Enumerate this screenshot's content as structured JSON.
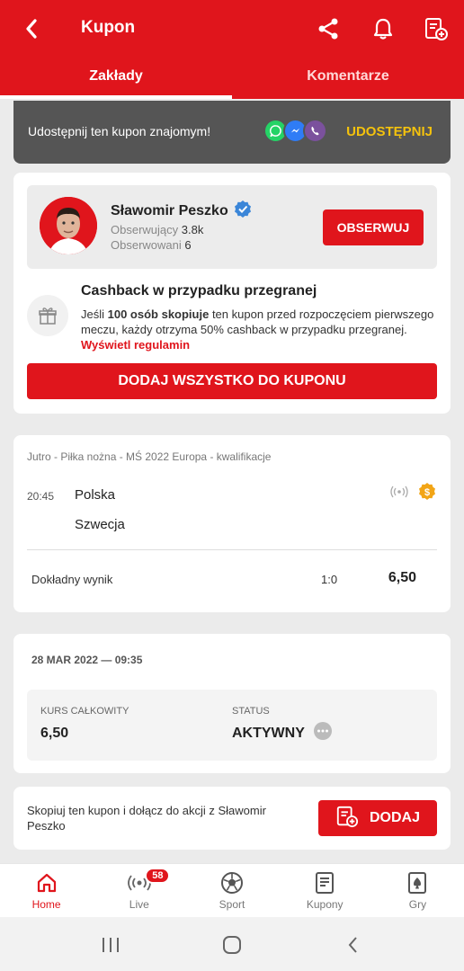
{
  "header": {
    "title": "Kupon",
    "icons": [
      "back-icon",
      "share-icon",
      "bell-icon",
      "coupon-add-icon"
    ],
    "tabs": [
      {
        "label": "Zakłady",
        "active": true
      },
      {
        "label": "Komentarze",
        "active": false
      }
    ]
  },
  "share_bar": {
    "text": "Udostępnij ten kupon znajomym!",
    "button": "UDOSTĘPNIJ",
    "apps": [
      "whatsapp-icon",
      "messenger-icon",
      "viber-icon"
    ]
  },
  "profile": {
    "name": "Sławomir Peszko",
    "followers_label": "Obserwujący",
    "followers_value": "3.8k",
    "following_label": "Obserwowani",
    "following_value": "6",
    "follow_button": "OBSERWUJ"
  },
  "cashback": {
    "title": "Cashback w przypadku przegranej",
    "text_1": "Jeśli ",
    "text_bold_1": "100 osób skopiuje",
    "text_2": " ten kupon przed rozpoczęciem pierwszego meczu, każdy otrzyma 50% cashback w przypadku przegranej. ",
    "link": "Wyświetl regulamin",
    "add_all_button": "DODAJ WSZYSTKO DO KUPONU"
  },
  "event": {
    "header": "Jutro - Piłka nożna - MŚ 2022 Europa - kwalifikacje",
    "time": "20:45",
    "home_team": "Polska",
    "away_team": "Szwecja",
    "market": "Dokładny wynik",
    "pick": "1:0",
    "odds": "6,50"
  },
  "summary": {
    "date": "28 MAR 2022 — 09:35",
    "total_odds_label": "KURS CAŁKOWITY",
    "total_odds_value": "6,50",
    "status_label": "STATUS",
    "status_value": "AKTYWNY"
  },
  "copy_bar": {
    "text": "Skopiuj ten kupon i dołącz do akcji z Sławomir Peszko",
    "button": "DODAJ"
  },
  "bottom_nav": [
    {
      "label": "Home",
      "icon": "home-icon",
      "active": true
    },
    {
      "label": "Live",
      "icon": "live-icon",
      "badge": "58"
    },
    {
      "label": "Sport",
      "icon": "soccer-ball-icon"
    },
    {
      "label": "Kupony",
      "icon": "coupon-icon"
    },
    {
      "label": "Gry",
      "icon": "cards-icon"
    }
  ],
  "colors": {
    "brand": "#e0151c",
    "accent_yellow": "#f4c20d",
    "share_bar": "#555555"
  }
}
